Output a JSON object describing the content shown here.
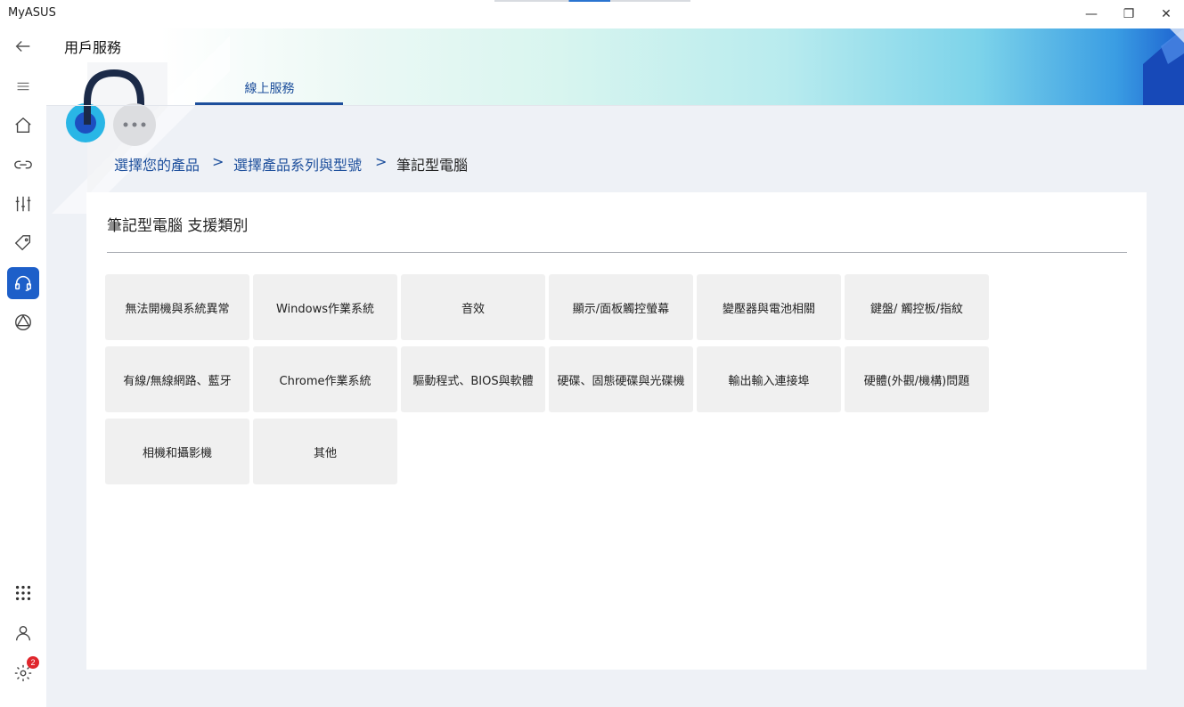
{
  "window": {
    "app_title": "MyASUS",
    "minimize_glyph": "—",
    "maximize_glyph": "❐",
    "close_glyph": "✕"
  },
  "sidebar": {
    "items": [
      {
        "name": "back",
        "icon": "back-arrow-icon"
      },
      {
        "name": "menu",
        "icon": "hamburger-menu-icon"
      },
      {
        "name": "home",
        "icon": "home-icon"
      },
      {
        "name": "link",
        "icon": "link-icon"
      },
      {
        "name": "customization",
        "icon": "sliders-icon"
      },
      {
        "name": "promotions",
        "icon": "tag-icon"
      },
      {
        "name": "customer-support",
        "icon": "headset-icon",
        "active": true
      },
      {
        "name": "recommendations",
        "icon": "triangle-circle-icon"
      },
      {
        "name": "apps",
        "icon": "app-grid-icon"
      },
      {
        "name": "account",
        "icon": "user-icon"
      },
      {
        "name": "settings",
        "icon": "gear-icon",
        "badge": "2"
      }
    ]
  },
  "header": {
    "title": "用戶服務",
    "tabs": [
      {
        "label": "線上服務",
        "active": true
      }
    ]
  },
  "breadcrumb": {
    "items": [
      "選擇您的產品",
      "選擇產品系列與型號",
      "筆記型電腦"
    ],
    "separator": ">"
  },
  "main": {
    "section_title": "筆記型電腦 支援類別",
    "categories": [
      "無法開機與系統異常",
      "Windows作業系統",
      "音效",
      "顯示/面板觸控螢幕",
      "變壓器與電池相關",
      "鍵盤/ 觸控板/指紋",
      "有線/無線網路、藍牙",
      "Chrome作業系統",
      "驅動程式、BIOS與軟體",
      "硬碟、固態硬碟與光碟機",
      "輸出輸入連接埠",
      "硬體(外觀/機構)問題",
      "相機和攝影機",
      "其他"
    ]
  },
  "colors": {
    "accent": "#1d4f9c",
    "active_nav": "#1d5fc9",
    "badge": "#e0262c",
    "tile_bg": "#f0f0f0"
  }
}
